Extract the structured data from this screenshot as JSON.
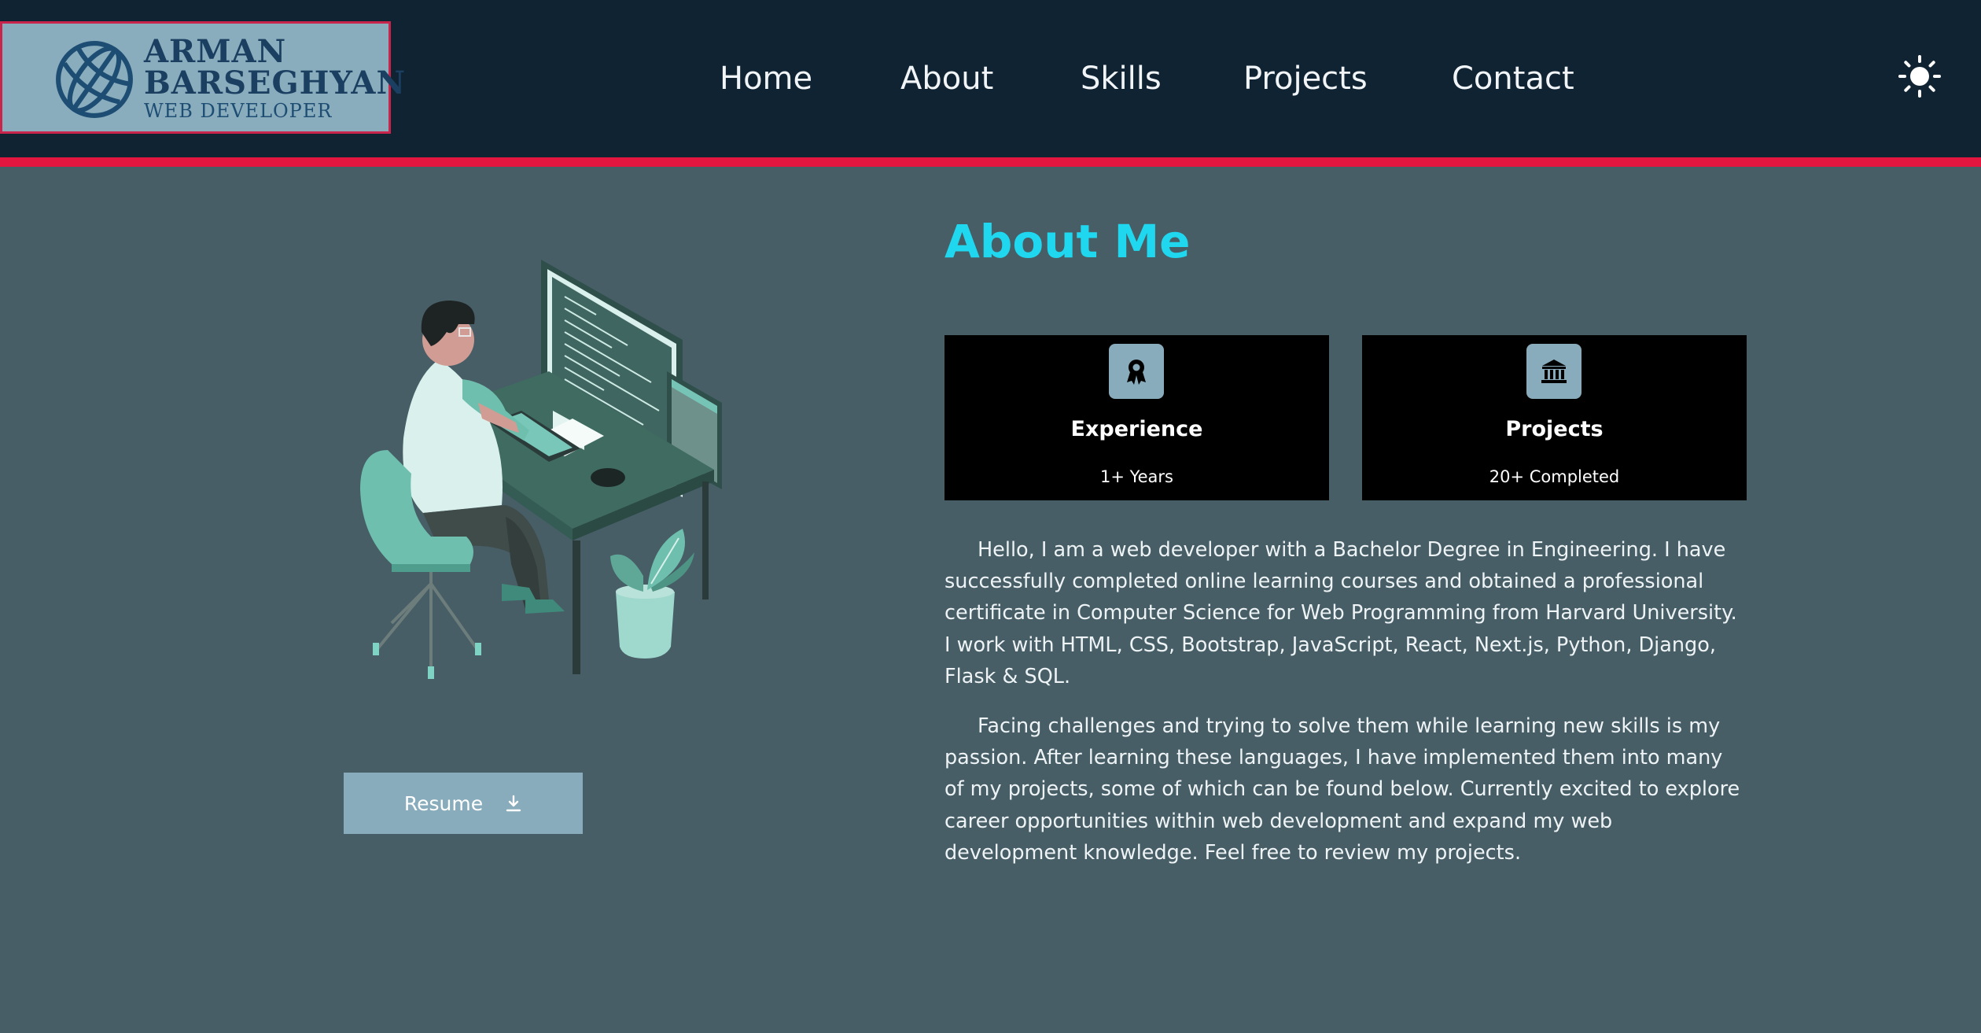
{
  "logo": {
    "name_line1": "ARMAN",
    "name_line2": "BARSEGHYAN",
    "subtitle": "WEB DEVELOPER",
    "icon": "globe-icon"
  },
  "nav": {
    "links": [
      "Home",
      "About",
      "Skills",
      "Projects",
      "Contact"
    ],
    "theme_icon": "sun-icon"
  },
  "colors": {
    "navbar": "#0f2333",
    "stripe": "#e3163f",
    "page_bg": "#475e66",
    "accent": "#1fd8ef",
    "button": "#88acbb",
    "card_bg": "#000000"
  },
  "about": {
    "title": "About Me",
    "cards": [
      {
        "icon": "award-icon",
        "title": "Experience",
        "value": "1+ Years"
      },
      {
        "icon": "bank-icon",
        "title": "Projects",
        "value": "20+ Completed"
      }
    ],
    "paragraphs": [
      "Hello, I am a web developer with a Bachelor Degree in Engineering. I have successfully completed online learning courses and obtained a professional certificate in Computer Science for Web Programming from Harvard University. I work with HTML, CSS, Bootstrap, JavaScript, React, Next.js, Python, Django, Flask & SQL.",
      "Facing challenges and trying to solve them while learning new skills is my passion. After learning these languages, I have implemented them into many of my projects, some of which can be found below. Currently excited to explore career opportunities within web development and expand my web development knowledge. Feel free to review my projects."
    ]
  },
  "resume": {
    "label": "Resume",
    "icon": "download-icon"
  }
}
